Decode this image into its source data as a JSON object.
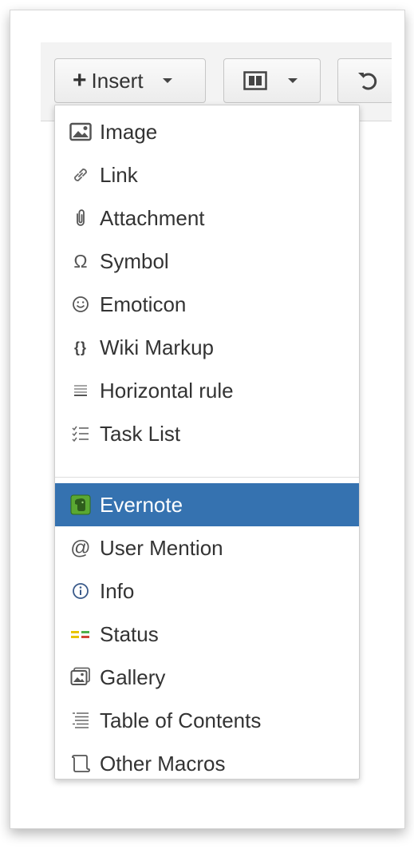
{
  "toolbar": {
    "insert_label": "Insert",
    "plus_glyph": "+",
    "layout_icon": "layout-columns-icon",
    "undo_icon": "undo-icon"
  },
  "menu": {
    "items": [
      {
        "label": "Image",
        "icon": "image-icon"
      },
      {
        "label": "Link",
        "icon": "link-icon"
      },
      {
        "label": "Attachment",
        "icon": "paperclip-icon"
      },
      {
        "label": "Symbol",
        "icon": "omega-icon"
      },
      {
        "label": "Emoticon",
        "icon": "smiley-icon"
      },
      {
        "label": "Wiki Markup",
        "icon": "curly-braces-icon"
      },
      {
        "label": "Horizontal rule",
        "icon": "horizontal-rule-icon"
      },
      {
        "label": "Task List",
        "icon": "task-list-icon"
      },
      {
        "label": "Evernote",
        "icon": "evernote-icon",
        "active": true
      },
      {
        "label": "User Mention",
        "icon": "at-sign-icon"
      },
      {
        "label": "Info",
        "icon": "info-icon"
      },
      {
        "label": "Status",
        "icon": "status-icon"
      },
      {
        "label": "Gallery",
        "icon": "gallery-icon"
      },
      {
        "label": "Table of Contents",
        "icon": "table-of-contents-icon"
      },
      {
        "label": "Other Macros",
        "icon": "macros-icon"
      }
    ]
  },
  "colors": {
    "active_bg": "#3572b0",
    "text": "#333333",
    "evernote_green": "#5aa832",
    "status_green": "#4fb04a",
    "status_yellow": "#e8c400"
  }
}
